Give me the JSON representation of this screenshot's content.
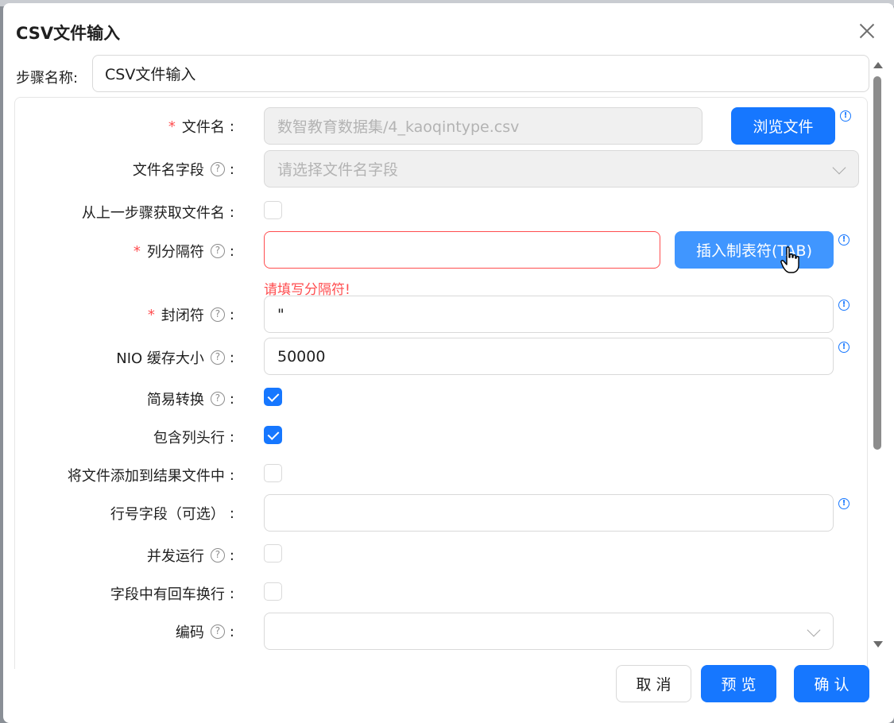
{
  "dialog": {
    "title": "CSV文件输入",
    "close_icon": "close-icon"
  },
  "step_name": {
    "label": "步骤名称:",
    "value": "CSV文件输入"
  },
  "form": {
    "filename": {
      "label": "文件名",
      "placeholder": "数智教育数据集/4_kaoqintype.csv",
      "browse_label": "浏览文件"
    },
    "filename_field": {
      "label": "文件名字段",
      "placeholder": "请选择文件名字段"
    },
    "from_prev_step": {
      "label": "从上一步骤获取文件名",
      "checked": false
    },
    "separator": {
      "label": "列分隔符",
      "value": "",
      "insert_tab_label": "插入制表符(TAB)",
      "error": "请填写分隔符!"
    },
    "enclosure": {
      "label": "封闭符",
      "value": "\""
    },
    "nio_buffer": {
      "label": "NIO 缓存大小",
      "value": "50000"
    },
    "lazy_conversion": {
      "label": "简易转换",
      "checked": true
    },
    "header_row": {
      "label": "包含列头行",
      "checked": true
    },
    "add_to_result": {
      "label": "将文件添加到结果文件中",
      "checked": false
    },
    "row_number_field": {
      "label": "行号字段（可选）",
      "value": ""
    },
    "parallel": {
      "label": "并发运行",
      "checked": false
    },
    "newline_in_field": {
      "label": "字段中有回车换行",
      "checked": false
    },
    "encoding": {
      "label": "编码",
      "value": ""
    }
  },
  "footer": {
    "cancel_label": "取 消",
    "preview_label": "预 览",
    "confirm_label": "确 认"
  },
  "colors": {
    "primary": "#1677ff",
    "error": "#ff4d4f"
  }
}
